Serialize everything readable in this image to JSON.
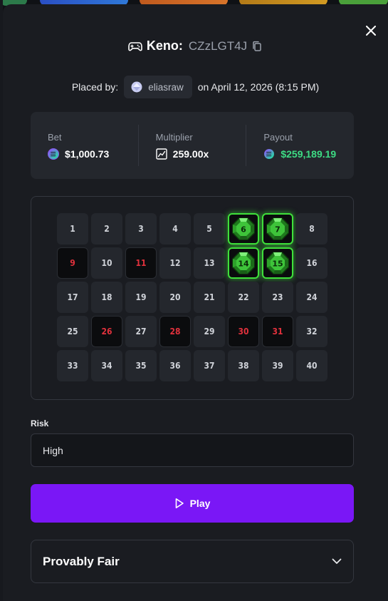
{
  "game": {
    "name": "Keno:",
    "bet_id": "CZzLGT4J"
  },
  "placed": {
    "prefix": "Placed by:",
    "username": "eliasraw",
    "date_text": "on April 12, 2026 (8:15 PM)"
  },
  "stats": {
    "bet_label": "Bet",
    "bet_value": "$1,000.73",
    "multiplier_label": "Multiplier",
    "multiplier_value": "259.00x",
    "payout_label": "Payout",
    "payout_value": "$259,189.19"
  },
  "board": {
    "tiles": [
      {
        "n": "1",
        "s": "plain"
      },
      {
        "n": "2",
        "s": "plain"
      },
      {
        "n": "3",
        "s": "plain"
      },
      {
        "n": "4",
        "s": "plain"
      },
      {
        "n": "5",
        "s": "plain"
      },
      {
        "n": "6",
        "s": "hit"
      },
      {
        "n": "7",
        "s": "hit"
      },
      {
        "n": "8",
        "s": "plain"
      },
      {
        "n": "9",
        "s": "miss"
      },
      {
        "n": "10",
        "s": "plain"
      },
      {
        "n": "11",
        "s": "miss"
      },
      {
        "n": "12",
        "s": "plain"
      },
      {
        "n": "13",
        "s": "plain"
      },
      {
        "n": "14",
        "s": "hit"
      },
      {
        "n": "15",
        "s": "hit"
      },
      {
        "n": "16",
        "s": "plain"
      },
      {
        "n": "17",
        "s": "plain"
      },
      {
        "n": "18",
        "s": "plain"
      },
      {
        "n": "19",
        "s": "plain"
      },
      {
        "n": "20",
        "s": "plain"
      },
      {
        "n": "21",
        "s": "plain"
      },
      {
        "n": "22",
        "s": "plain"
      },
      {
        "n": "23",
        "s": "plain"
      },
      {
        "n": "24",
        "s": "plain"
      },
      {
        "n": "25",
        "s": "plain"
      },
      {
        "n": "26",
        "s": "miss"
      },
      {
        "n": "27",
        "s": "plain"
      },
      {
        "n": "28",
        "s": "miss"
      },
      {
        "n": "29",
        "s": "plain"
      },
      {
        "n": "30",
        "s": "miss"
      },
      {
        "n": "31",
        "s": "miss"
      },
      {
        "n": "32",
        "s": "plain"
      },
      {
        "n": "33",
        "s": "plain"
      },
      {
        "n": "34",
        "s": "plain"
      },
      {
        "n": "35",
        "s": "plain"
      },
      {
        "n": "36",
        "s": "plain"
      },
      {
        "n": "37",
        "s": "plain"
      },
      {
        "n": "38",
        "s": "plain"
      },
      {
        "n": "39",
        "s": "plain"
      },
      {
        "n": "40",
        "s": "plain"
      }
    ]
  },
  "risk": {
    "label": "Risk",
    "value": "High"
  },
  "play_button": {
    "label": "Play"
  },
  "provably_fair": {
    "title": "Provably Fair"
  },
  "colors": {
    "accent": "#7a17f6",
    "hit": "#3fe03b",
    "miss": "#e0313c",
    "payout": "#3ddc84"
  },
  "icons": {
    "title": "gamepad-icon",
    "copy": "copy-icon",
    "avatar": "avatar",
    "currency": "solana-coin-icon",
    "multiplier": "trend-chart-icon",
    "gem": "gem-icon",
    "play": "play-icon",
    "expand": "chevron-down-icon",
    "close": "close-icon"
  }
}
